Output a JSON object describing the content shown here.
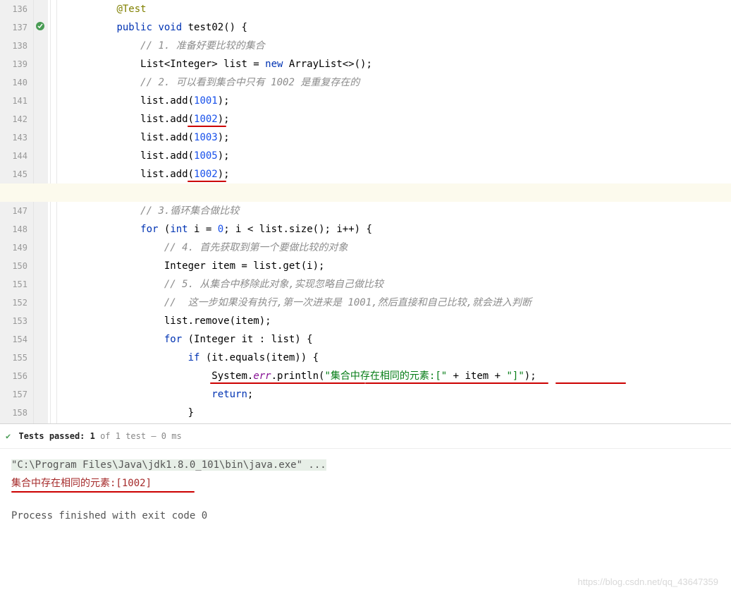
{
  "lines": {
    "start": 136,
    "end": 158
  },
  "code": {
    "l136_annotation": "@Test",
    "l137_pub": "public",
    "l137_void": "void",
    "l137_name": " test02",
    "l137_rest": "() {",
    "l138_comment": "// 1. 准备好要比较的集合",
    "l139_a": "List<Integer> list = ",
    "l139_new": "new",
    "l139_b": " ArrayList<>();",
    "l140_comment": "// 2. 可以看到集合中只有 1002 是重复存在的",
    "l141_a": "list.add(",
    "l141_n": "1001",
    "l141_b": ");",
    "l142_a": "list.add(",
    "l142_n": "1002",
    "l142_b": ");",
    "l143_a": "list.add(",
    "l143_n": "1003",
    "l143_b": ");",
    "l144_a": "list.add(",
    "l144_n": "1005",
    "l144_b": ");",
    "l145_a": "list.add(",
    "l145_n": "1002",
    "l145_b": ");",
    "l147_comment": "// 3.循环集合做比较",
    "l148_for": "for",
    "l148_a": " (",
    "l148_int": "int",
    "l148_b": " i = ",
    "l148_zero": "0",
    "l148_c": "; i < list.size(); i++) {",
    "l149_comment": "// 4. 首先获取到第一个要做比较的对象",
    "l150": "Integer item = list.get(i);",
    "l151_comment": "// 5. 从集合中移除此对象,实现忽略自己做比较",
    "l152_comment": "//  这一步如果没有执行,第一次进来是 1001,然后直接和自己比较,就会进入判断",
    "l153": "list.remove(item);",
    "l154_for": "for",
    "l154_a": " (Integer it : list) {",
    "l155_if": "if",
    "l155_a": " (it.equals(item)) {",
    "l156_a": "System.",
    "l156_err": "err",
    "l156_b": ".println(",
    "l156_str1": "\"集合中存在相同的元素:[\"",
    "l156_c": " + item + ",
    "l156_str2": "\"]\"",
    "l156_d": ");",
    "l157_return": "return",
    "l157_semi": ";",
    "l158": "}"
  },
  "indents": {
    "i8": "        ",
    "i12": "            ",
    "i16": "                ",
    "i20": "                    ",
    "i24": "                        ",
    "i28": "                            "
  },
  "test_status": {
    "prefix": "Tests passed:",
    "count": "1",
    "of": " of 1 test – 0 ms"
  },
  "console": {
    "cmd": "\"C:\\Program Files\\Java\\jdk1.8.0_101\\bin\\java.exe\" ...",
    "err_output": "集合中存在相同的元素:[1002]",
    "exit": "Process finished with exit code 0"
  },
  "watermark": "https://blog.csdn.net/qq_43647359"
}
